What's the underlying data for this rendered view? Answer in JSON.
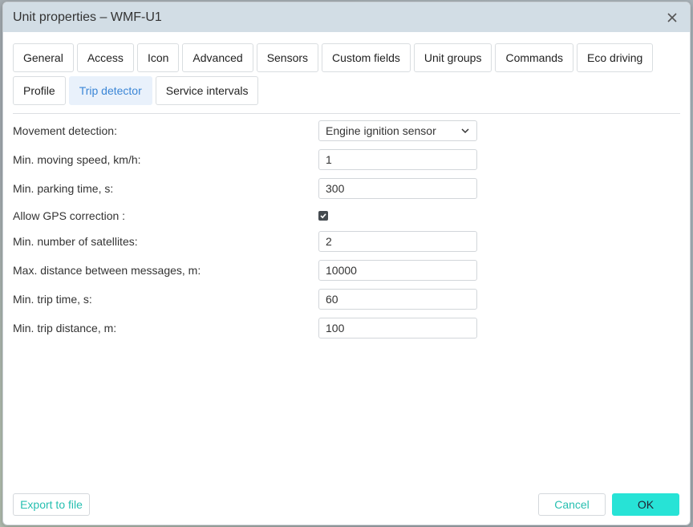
{
  "window": {
    "title": "Unit properties – WMF-U1"
  },
  "tabs": [
    {
      "label": "General"
    },
    {
      "label": "Access"
    },
    {
      "label": "Icon"
    },
    {
      "label": "Advanced"
    },
    {
      "label": "Sensors"
    },
    {
      "label": "Custom fields"
    },
    {
      "label": "Unit groups"
    },
    {
      "label": "Commands"
    },
    {
      "label": "Eco driving"
    },
    {
      "label": "Profile"
    },
    {
      "label": "Trip detector"
    },
    {
      "label": "Service intervals"
    }
  ],
  "active_tab": "Trip detector",
  "form": {
    "movement_detection": {
      "label": "Movement detection:",
      "value": "Engine ignition sensor"
    },
    "min_moving_speed": {
      "label": "Min. moving speed, km/h:",
      "value": "1"
    },
    "min_parking_time": {
      "label": "Min. parking time, s:",
      "value": "300"
    },
    "allow_gps_correction": {
      "label": "Allow GPS correction :",
      "checked": true
    },
    "min_satellites": {
      "label": "Min. number of satellites:",
      "value": "2"
    },
    "max_distance": {
      "label": "Max. distance between messages, m:",
      "value": "10000"
    },
    "min_trip_time": {
      "label": "Min. trip time, s:",
      "value": "60"
    },
    "min_trip_distance": {
      "label": "Min. trip distance, m:",
      "value": "100"
    }
  },
  "footer": {
    "export_label": "Export to file",
    "cancel_label": "Cancel",
    "ok_label": "OK"
  },
  "colors": {
    "accent": "#26bfb0",
    "ok_button": "#27e3d6",
    "active_tab_text": "#3b86d6",
    "titlebar": "#d2dde5"
  },
  "icons": {
    "close": "close-icon",
    "dropdown": "chevron-down-icon",
    "check": "check-icon"
  }
}
